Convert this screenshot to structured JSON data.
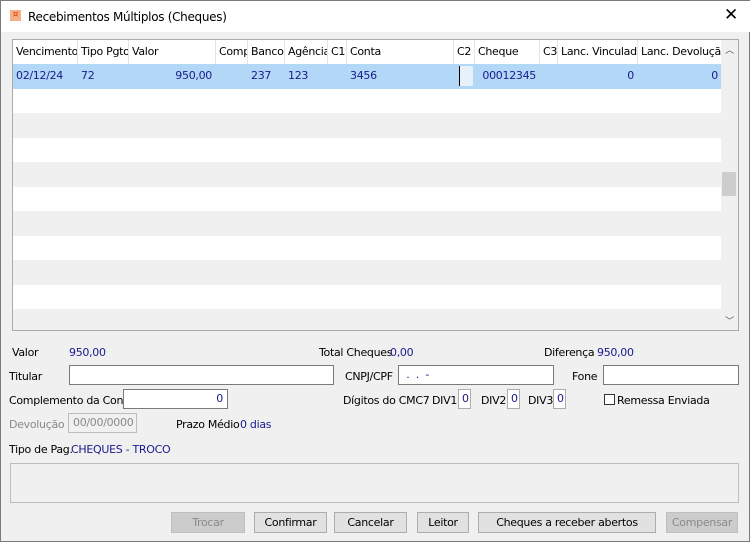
{
  "window": {
    "title": "Recebimentos Múltiplos (Cheques)",
    "close": "✕"
  },
  "grid": {
    "columns": [
      "Vencimento",
      "Tipo Pgto.",
      "Valor",
      "Comp.",
      "Banco",
      "Agência",
      "C1",
      "Conta",
      "C2",
      "Cheque",
      "C3",
      "Lanc. Vinculado",
      "Lanc. Devolução"
    ],
    "rows": [
      {
        "vencimento": "02/12/24",
        "tipo": "72",
        "valor": "950,00",
        "comp": "",
        "banco": "237",
        "agencia": "123",
        "c1": "",
        "conta": "3456",
        "c2": "",
        "cheque": "00012345",
        "c3": "",
        "lanc_vinculado": "0",
        "lanc_devolucao": "0"
      }
    ]
  },
  "summary": {
    "valor_label": "Valor",
    "valor": "950,00",
    "total_label": "Total Cheques",
    "total": "0,00",
    "diferenca_label": "Diferença",
    "diferenca": "950,00"
  },
  "form": {
    "titular_label": "Titular",
    "titular": "",
    "cnpj_label": "CNPJ/CPF",
    "cnpj": " .  .  -",
    "fone_label": "Fone",
    "fone": "",
    "complemento_label": "Complemento da Conta",
    "complemento": "0",
    "digitos_label": "Dígitos do CMC7",
    "div1_label": "DIV1",
    "div1": "0",
    "div2_label": "DIV2",
    "div2": "0",
    "div3_label": "DIV3",
    "div3": "0",
    "remessa_label": "Remessa Enviada",
    "devolucao_label": "Devolução",
    "devolucao": "00/00/0000",
    "prazo_label": "Prazo Médio",
    "prazo": "0 dias",
    "tipo_pag_label": "Tipo de Pag.",
    "tipo_pag": "CHEQUES - TROCO"
  },
  "buttons": {
    "trocar": "Trocar",
    "confirmar": "Confirmar",
    "cancelar": "Cancelar",
    "leitor": "Leitor",
    "cheques_abertos": "Cheques a receber abertos",
    "compensar": "Compensar"
  }
}
